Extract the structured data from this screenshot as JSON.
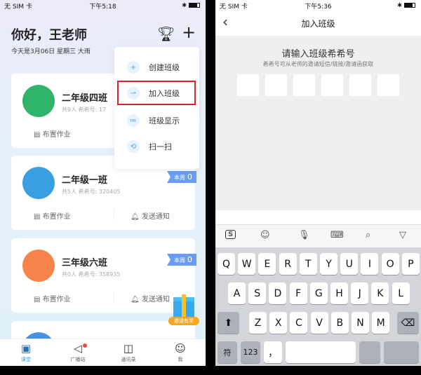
{
  "left": {
    "status": {
      "carrier": "无 SIM 卡",
      "time": "下午5:18"
    },
    "greeting": "你好，王老师",
    "date": "今天是3月06日 星期三 大雨",
    "classes": [
      {
        "name": "二年级四班",
        "info": "共9人  希希号: 17",
        "avatar_color": "#2eb56a"
      },
      {
        "name": "二年级一班",
        "info": "共5人  希希号: 320405",
        "week_label": "本周",
        "week_count": "0",
        "avatar_color": "#3a9fe0"
      },
      {
        "name": "三年级六班",
        "info": "共0人  希希号: 358935",
        "week_label": "本周",
        "week_count": "0",
        "avatar_color": "#f5834a"
      }
    ],
    "actions": {
      "homework": "布置作业",
      "notify": "发送通知"
    },
    "menu": [
      {
        "icon": "plus-icon",
        "glyph": "+",
        "label": "创建班级"
      },
      {
        "icon": "join-icon",
        "glyph": "⇀",
        "label": "加入班级",
        "highlighted": true
      },
      {
        "icon": "list-icon",
        "glyph": "≔",
        "label": "班级显示"
      },
      {
        "icon": "scan-icon",
        "glyph": "⟲",
        "label": "扫一扫"
      }
    ],
    "gift_label": "邀请有奖",
    "tabs": [
      {
        "label": "课堂",
        "glyph": "▣",
        "active": true
      },
      {
        "label": "广播站",
        "glyph": "◁"
      },
      {
        "label": "通讯录",
        "glyph": "◫"
      },
      {
        "label": "我",
        "glyph": "☺"
      }
    ],
    "accent": "#3a9fe0",
    "highlight_color": "#d8222a"
  },
  "right": {
    "status": {
      "carrier": "无 SIM 卡",
      "time": "下午5:36"
    },
    "nav_title": "加入班级",
    "prompt": "请输入班级希希号",
    "hint": "希希号可从老师的邀请短信/链接/邀请函获取",
    "code_values": [
      "",
      "",
      "",
      "",
      "",
      ""
    ],
    "keyboard": {
      "row1": [
        "Q",
        "W",
        "E",
        "R",
        "T",
        "Y",
        "U",
        "I",
        "O",
        "P"
      ],
      "row2": [
        "A",
        "S",
        "D",
        "F",
        "G",
        "H",
        "J",
        "K",
        "L"
      ],
      "row3": [
        "Z",
        "X",
        "C",
        "V",
        "B",
        "N",
        "M"
      ],
      "sym": "符",
      "num": "123",
      "punct": "，"
    }
  }
}
